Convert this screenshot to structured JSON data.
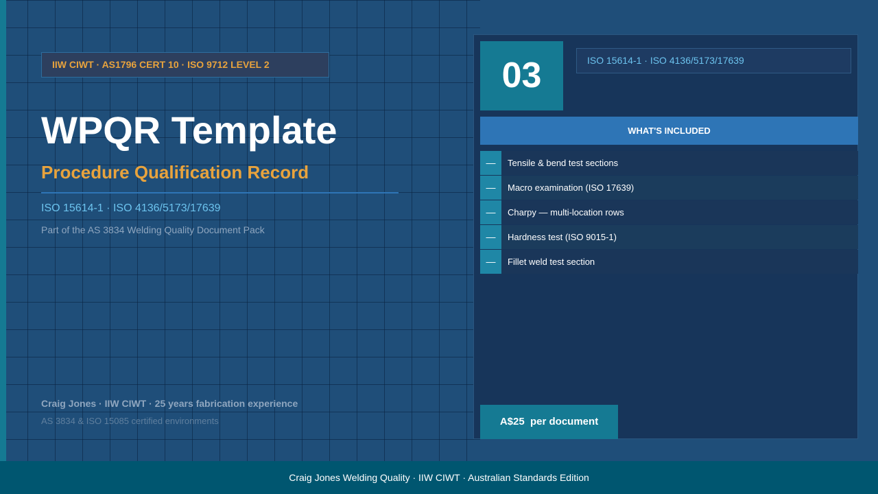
{
  "hero": {
    "cert_badge": "IIW CIWT  ·  AS1796 CERT 10  ·  ISO 9712 LEVEL 2",
    "title": "WPQR Template",
    "subtitle": "Procedure Qualification Record",
    "standards": "ISO 15614-1  ·  ISO 4136/5173/17639",
    "pack_note": "Part of the AS 3834 Welding Quality Document Pack",
    "author_line": "Craig Jones  ·  IIW CIWT  ·  25 years fabrication experience",
    "cert_environments": "AS 3834 & ISO 15085 certified environments"
  },
  "panel": {
    "number": "03",
    "standards": "ISO 15614-1  ·  ISO 4136/5173/17639",
    "included_header": "WHAT'S INCLUDED",
    "bullet_symbol": "—",
    "items": [
      "Tensile & bend test sections",
      "Macro examination (ISO 17639)",
      "Charpy — multi-location rows",
      "Hardness test (ISO 9015-1)",
      "Fillet weld test section"
    ],
    "price": "A$25  per document"
  },
  "footer": {
    "text": "Craig Jones Welding Quality  ·  IIW CIWT  ·  Australian Standards Edition"
  },
  "colors": {
    "background": "#1f4e79",
    "panel": "#17355a",
    "accent_teal": "#157a93",
    "accent_orange": "#e8a33d",
    "accent_blue": "#2e75b6",
    "link_blue": "#6cc3ee",
    "footer": "#005670"
  }
}
